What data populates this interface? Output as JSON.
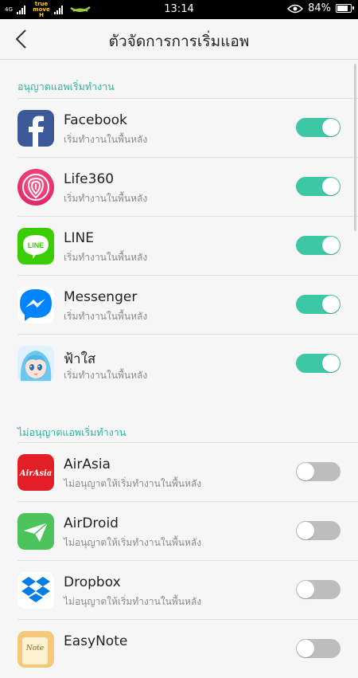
{
  "status_bar": {
    "network_type": "4G",
    "carrier": "true move H",
    "time": "13:14",
    "battery_percent": "84%",
    "battery_level": 0.84,
    "icons": [
      "signal-icon",
      "carrier-logo-icon",
      "eye-icon",
      "battery-icon"
    ]
  },
  "header": {
    "title": "ตัวจัดการการเริ่มแอพ",
    "back_icon": "chevron-left-icon"
  },
  "sections": [
    {
      "title": "อนุญาตแอพเริ่มทำงาน",
      "apps": [
        {
          "name": "Facebook",
          "subtitle": "เริ่มทำงานในพื้นหลัง",
          "enabled": true,
          "icon": "facebook-icon"
        },
        {
          "name": "Life360",
          "subtitle": "เริ่มทำงานในพื้นหลัง",
          "enabled": true,
          "icon": "life360-icon"
        },
        {
          "name": "LINE",
          "subtitle": "เริ่มทำงานในพื้นหลัง",
          "enabled": true,
          "icon": "line-icon"
        },
        {
          "name": "Messenger",
          "subtitle": "เริ่มทำงานในพื้นหลัง",
          "enabled": true,
          "icon": "messenger-icon"
        },
        {
          "name": "ฟ้าใส",
          "subtitle": "เริ่มทำงานในพื้นหลัง",
          "enabled": true,
          "icon": "anime-girl-icon"
        }
      ]
    },
    {
      "title": "ไม่อนุญาตแอพเริ่มทำงาน",
      "apps": [
        {
          "name": "AirAsia",
          "subtitle": "ไม่อนุญาตให้เริ่มทำงานในพื้นหลัง",
          "enabled": false,
          "icon": "airasia-icon"
        },
        {
          "name": "AirDroid",
          "subtitle": "ไม่อนุญาตให้เริ่มทำงานในพื้นหลัง",
          "enabled": false,
          "icon": "airdroid-icon"
        },
        {
          "name": "Dropbox",
          "subtitle": "ไม่อนุญาตให้เริ่มทำงานในพื้นหลัง",
          "enabled": false,
          "icon": "dropbox-icon"
        },
        {
          "name": "EasyNote",
          "subtitle": "",
          "enabled": false,
          "icon": "easynote-icon"
        }
      ]
    }
  ],
  "icon_texts": {
    "line": "LINE",
    "airasia": "AirAsia",
    "easynote": "Note"
  },
  "colors": {
    "accent": "#29b79a",
    "toggle_on": "#3dc7a4",
    "toggle_off": "#bdbdbd",
    "facebook": "#3b5998",
    "line": "#3acd01",
    "messenger": "#0084ff",
    "airasia": "#e41e26",
    "airdroid": "#4cc35b",
    "dropbox": "#007ee5"
  }
}
